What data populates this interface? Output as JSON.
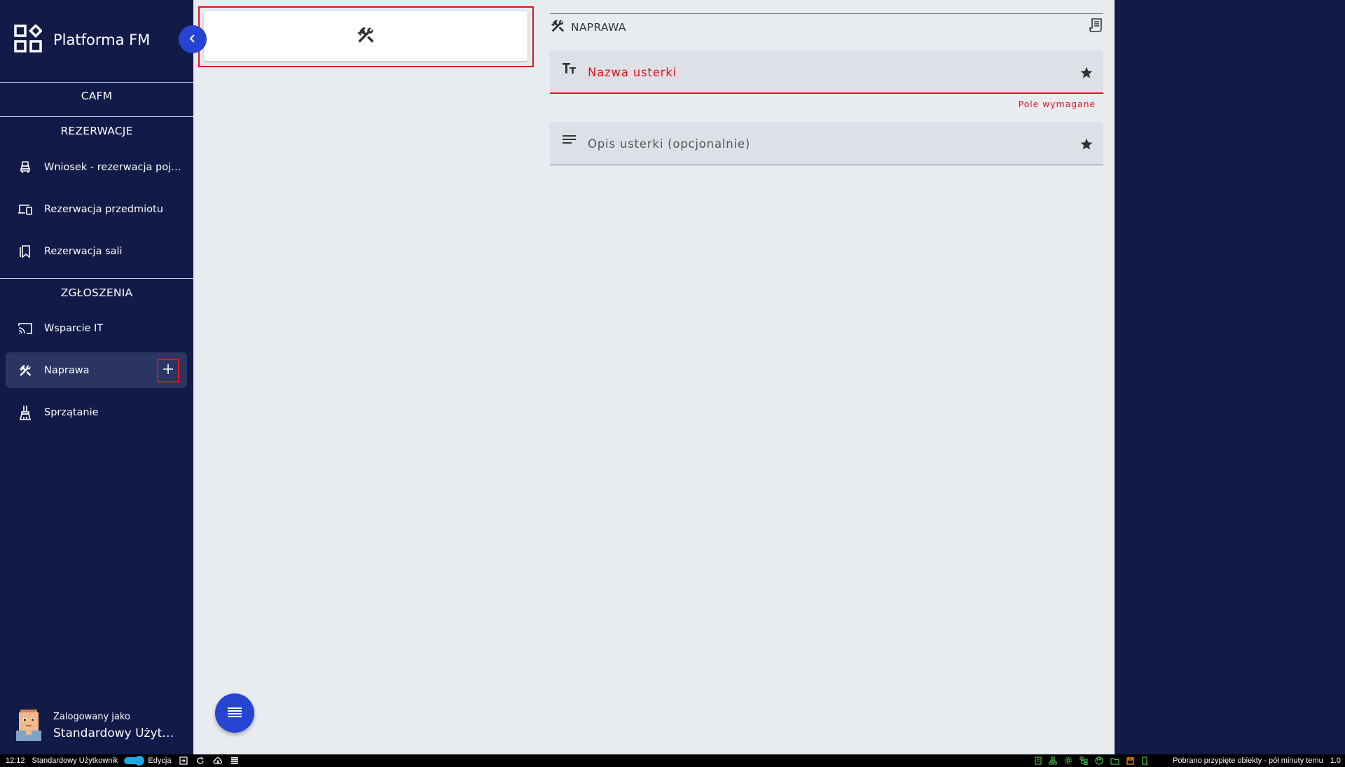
{
  "app": {
    "title": "Platforma FM"
  },
  "sidebar": {
    "module": "CAFM",
    "sections": [
      {
        "title": "REZERWACJE",
        "items": [
          {
            "label": "Wniosek - rezerwacja pojazdu",
            "icon": "car-seat-icon"
          },
          {
            "label": "Rezerwacja przedmiotu",
            "icon": "devices-icon"
          },
          {
            "label": "Rezerwacja sali",
            "icon": "bookmarks-icon"
          }
        ]
      },
      {
        "title": "ZGŁOSZENIA",
        "items": [
          {
            "label": "Wsparcie IT",
            "icon": "cast-icon"
          },
          {
            "label": "Naprawa",
            "icon": "tools-icon",
            "active": true
          },
          {
            "label": "Sprzątanie",
            "icon": "broom-icon"
          }
        ]
      }
    ],
    "user": {
      "caption": "Zalogowany jako",
      "name": "Standardowy Użytkownik"
    }
  },
  "form": {
    "header": "NAPRAWA",
    "fields": [
      {
        "label": "Nazwa usterki",
        "error": "Pole wymagane"
      },
      {
        "label": "Opis usterki (opcjonalnie)"
      }
    ]
  },
  "statusbar": {
    "time": "12:12",
    "user": "Standardowy Użytkownik",
    "mode": "Edycja",
    "status": "Pobrano przypięte obiekty - pół minuty temu",
    "version": "1.0"
  },
  "colors": {
    "sidebar": "#121a47",
    "accent": "#2544d1",
    "error": "#e0141e",
    "main_bg": "#e8ecf1"
  }
}
